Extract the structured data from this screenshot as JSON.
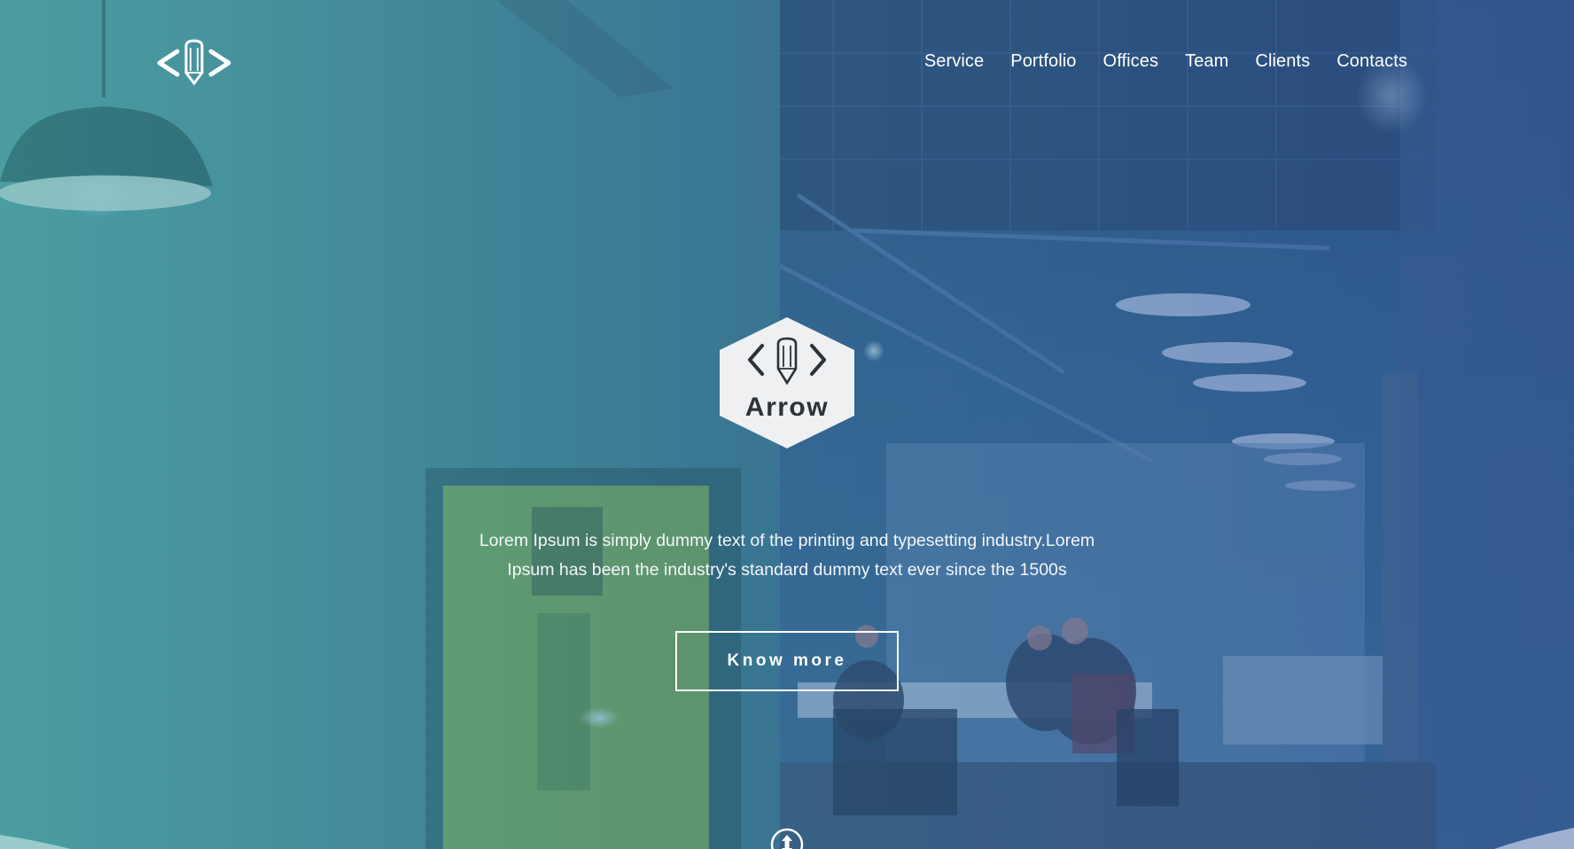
{
  "site": {
    "logo_icon": "code-pencil-logo-icon"
  },
  "nav": {
    "items": [
      {
        "label": "Service"
      },
      {
        "label": "Portfolio"
      },
      {
        "label": "Offices"
      },
      {
        "label": "Team"
      },
      {
        "label": "Clients"
      },
      {
        "label": "Contacts"
      }
    ]
  },
  "hero": {
    "badge_title": "Arrow",
    "badge_icon": "code-pencil-icon",
    "description": "Lorem Ipsum is simply dummy text of the printing and typesetting industry.Lorem Ipsum has been the industry's standard dummy text ever since the 1500s",
    "cta_label": "Know more",
    "scroll_icon": "scroll-down-icon"
  },
  "colors": {
    "overlay_left": "#48a0a0",
    "overlay_right": "#2a5096",
    "badge_bg": "#eef0f2",
    "text": "#ffffff"
  }
}
